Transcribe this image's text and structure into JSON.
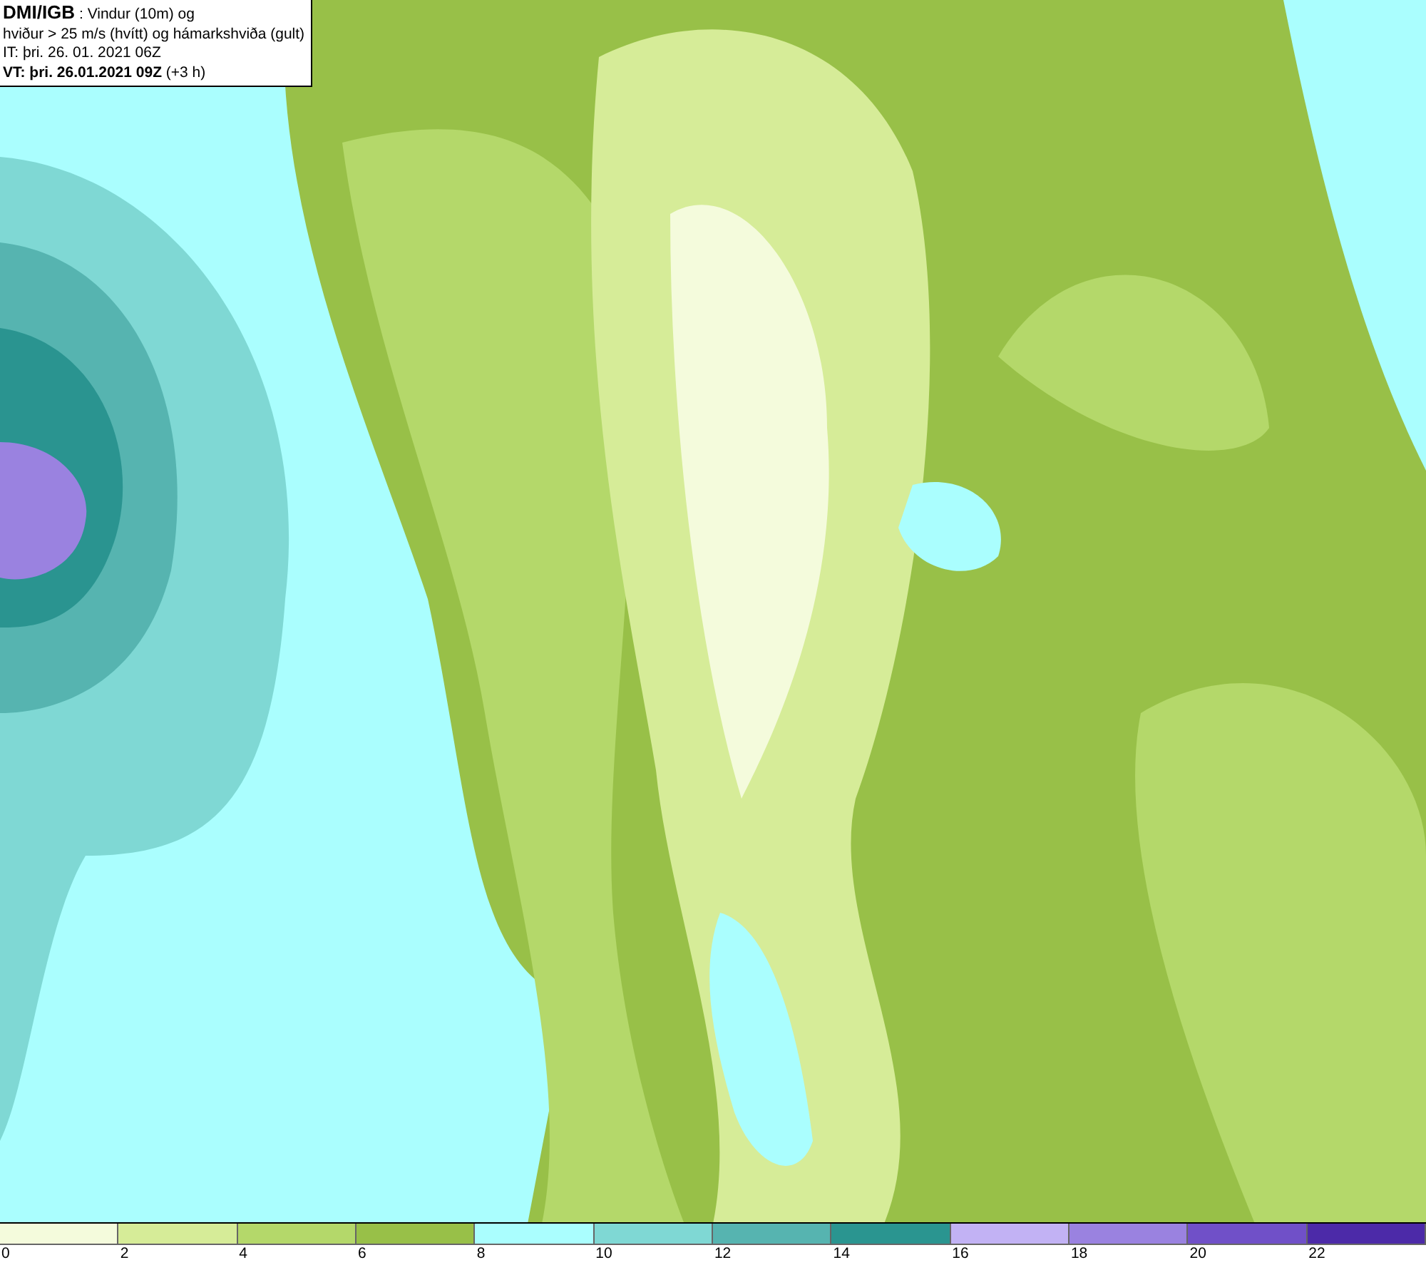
{
  "info_box": {
    "lines": [
      "**DMI/IGB** : Vindur (10m) og",
      "hviður > 25 m/s (hvítt) og hámarkshviða (gult)",
      "IT: þri. 26. 01. 2021 06Z",
      "**VT: þri. 26.01.2021 09Z** (+3 h)"
    ]
  },
  "legend": [
    {
      "label": "0",
      "color": "#f4fbdc"
    },
    {
      "label": "2",
      "color": "#d6ec98"
    },
    {
      "label": "4",
      "color": "#b4d86a"
    },
    {
      "label": "6",
      "color": "#98c048"
    },
    {
      "label": "8",
      "color": "#aafefe"
    },
    {
      "label": "10",
      "color": "#7fd8d4"
    },
    {
      "label": "12",
      "color": "#56b4b0"
    },
    {
      "label": "14",
      "color": "#2a9590"
    },
    {
      "label": "16",
      "color": "#c2b2f4"
    },
    {
      "label": "18",
      "color": "#9a82e0"
    },
    {
      "label": "20",
      "color": "#7050c8"
    },
    {
      "label": "22",
      "color": "#4c2aa8"
    }
  ]
}
